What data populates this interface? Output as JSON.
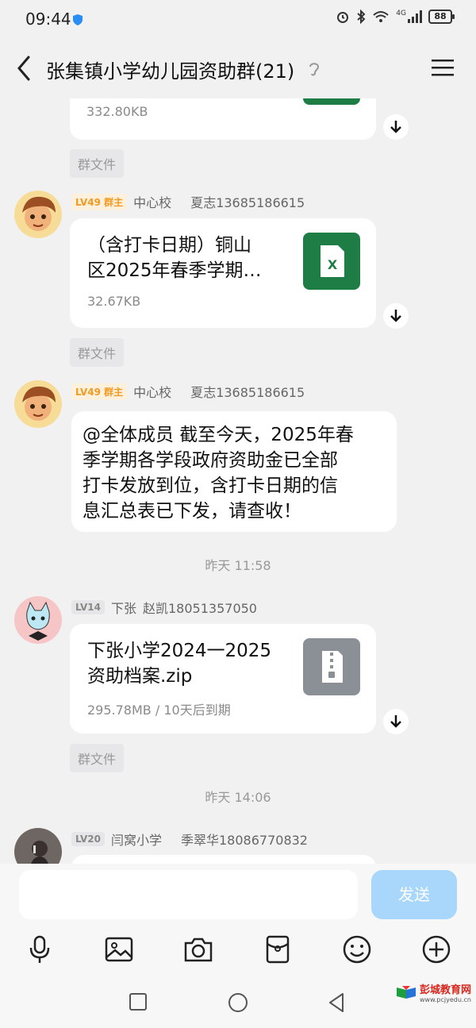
{
  "status": {
    "time": "09:44",
    "network": "4G",
    "battery": "88"
  },
  "header": {
    "title": "张集镇小学幼儿园资助群(21)"
  },
  "messages": {
    "m0": {
      "size": "332.80KB",
      "tag": "群文件"
    },
    "m1": {
      "badge": "LV49 群主",
      "group": "中心校",
      "sender": "夏志13685186615",
      "line1": "（含打卡日期）铜山",
      "line2": "区2025年春季学期…",
      "size": "32.67KB",
      "tag": "群文件",
      "icon_letter": "X"
    },
    "m2": {
      "badge": "LV49 群主",
      "group": "中心校",
      "sender": "夏志13685186615",
      "lines": [
        "@全体成员 截至今天，2025年春",
        "季学期各学段政府资助金已全部",
        "打卡发放到位，含打卡日期的信",
        "息汇总表已下发，请查收！"
      ]
    },
    "time1": "昨天 11:58",
    "m3": {
      "badge": "LV14",
      "group": "下张",
      "sender": "赵凯18051357050",
      "line1": "下张小学2024一2025",
      "line2": "资助档案.zip",
      "size": "295.78MB / 10天后到期",
      "tag": "群文件"
    },
    "time2": "昨天 14:06",
    "m4": {
      "badge": "LV20",
      "group": "闫窝小学",
      "sender": "季翠华18086770832"
    }
  },
  "input": {
    "placeholder": "",
    "send_label": "发送"
  },
  "toolbar": {
    "icons": [
      "mic-icon",
      "image-icon",
      "camera-icon",
      "red-packet-icon",
      "emoji-icon",
      "plus-icon"
    ]
  },
  "watermark": {
    "title": "彭城教育网",
    "site": "www.pcjyedu.cn"
  },
  "colors": {
    "accent": "#a8d7fb",
    "excel": "#1d7d45",
    "zip": "#8b9097",
    "owner_badge": "#f29a22"
  }
}
